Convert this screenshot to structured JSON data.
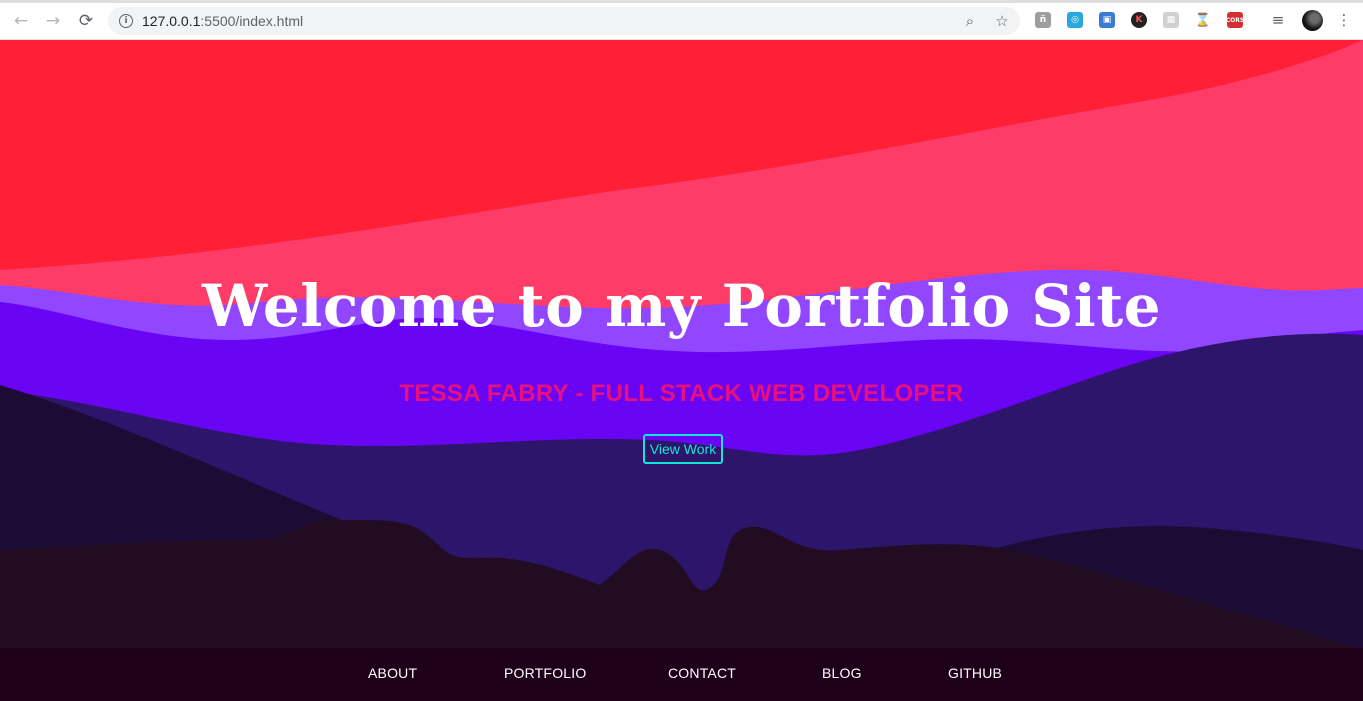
{
  "browser": {
    "url_host": "127.0.0.1",
    "url_path": ":5500/index.html",
    "icons": {
      "back": "back-arrow-icon",
      "forward": "forward-arrow-icon",
      "reload": "reload-icon",
      "site_info": "info-icon",
      "zoom": "zoom-icon",
      "bookmark": "star-icon",
      "media": "media-control-icon",
      "menu": "kebab-menu-icon"
    },
    "extensions": [
      {
        "name": "extension-a-icon",
        "glyph": "ñ",
        "color": "#9e9e9e"
      },
      {
        "name": "extension-blue-circle-icon",
        "glyph": "◎",
        "color": "#29a8e0"
      },
      {
        "name": "extension-blue-square-icon",
        "glyph": "▣",
        "color": "#3a7bd5"
      },
      {
        "name": "extension-k-icon",
        "glyph": "K",
        "color": "#222222"
      },
      {
        "name": "extension-grid-icon",
        "glyph": "▦",
        "color": "#d0d0d0"
      },
      {
        "name": "extension-hourglass-icon",
        "glyph": "⌛",
        "color": "#e7a21b"
      },
      {
        "name": "extension-cors-icon",
        "glyph": "CORS",
        "color": "#d32f2f"
      }
    ]
  },
  "hero": {
    "title": "Welcome to my Portfolio Site",
    "subtitle": "TESSA FABRY - FULL STACK WEB DEVELOPER",
    "button_label": "View Work"
  },
  "colors": {
    "sky_top": "#ff2038",
    "sky_pink": "#ff3b68",
    "violet_light": "#9146ff",
    "violet": "#6a04f5",
    "indigo": "#2c156a",
    "dark_plum": "#1c0c35",
    "ground": "#210c22",
    "footer": "#1e0018",
    "subtitle": "#e6117c",
    "button": "#14e6d8"
  },
  "footer": {
    "links": [
      "ABOUT",
      "PORTFOLIO",
      "CONTACT",
      "BLOG",
      "GITHUB"
    ]
  }
}
